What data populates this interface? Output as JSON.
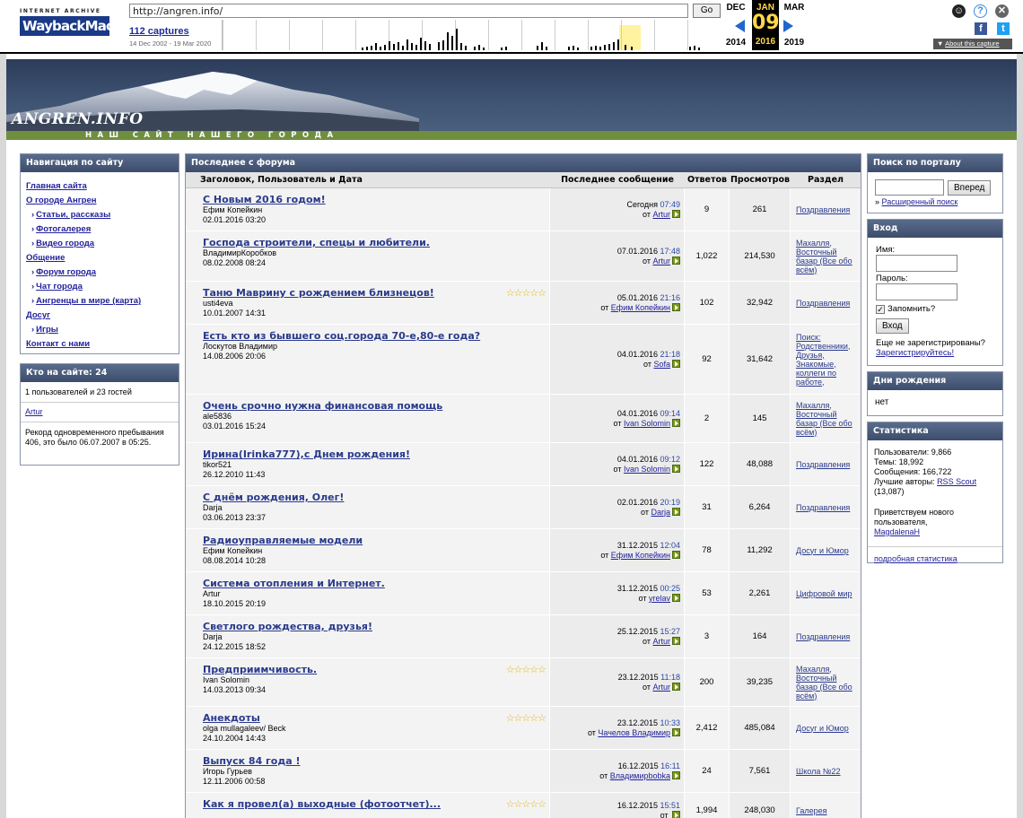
{
  "wayback": {
    "logo_top": "INTERNET ARCHIVE",
    "logo_main": "WaybackMachine",
    "url": "http://angren.info/",
    "go_label": "Go",
    "captures": "112 captures",
    "range": "14 Dec 2002 - 19 Mar 2020",
    "prev_month": "DEC",
    "cur_month": "JAN",
    "next_month": "MAR",
    "cur_day": "09",
    "prev_year": "2014",
    "cur_year": "2016",
    "next_year": "2019",
    "about": "About this capture"
  },
  "site": {
    "logo": "ANGREN.INFO",
    "tagline": "НАШ САЙТ НАШЕГО ГОРОДА"
  },
  "nav": {
    "title": "Навигация по сайту",
    "items": [
      {
        "label": "Главная сайта",
        "sub": false
      },
      {
        "label": "О городе Ангрен",
        "sub": false
      },
      {
        "label": "Статьи, рассказы",
        "sub": true
      },
      {
        "label": "Фотогалерея",
        "sub": true
      },
      {
        "label": "Видео города",
        "sub": true
      },
      {
        "label": "Общение",
        "sub": false
      },
      {
        "label": "Форум города",
        "sub": true
      },
      {
        "label": "Чат города",
        "sub": true
      },
      {
        "label": "Ангренцы в мире (карта)",
        "sub": true
      },
      {
        "label": "Досуг",
        "sub": false
      },
      {
        "label": "Игры",
        "sub": true
      },
      {
        "label": "Контакт с нами",
        "sub": false
      }
    ]
  },
  "online": {
    "title": "Кто на сайте: 24",
    "summary": "1 пользователей и 23 гостей",
    "user": "Artur",
    "record": "Рекорд одновременного пребывания 406, это было 06.07.2007 в 05:25."
  },
  "forum": {
    "title": "Последнее с форума",
    "headers": {
      "topic": "Заголовок, Пользователь и Дата",
      "last": "Последнее сообщение",
      "replies": "Ответов",
      "views": "Просмотров",
      "section": "Раздел"
    },
    "rows": [
      {
        "title": "С Новым 2016 годом!",
        "user": "Ефим Копейкин",
        "date": "02.01.2016 03:20",
        "stars": false,
        "last_date": "Сегодня",
        "last_time": "07:49",
        "last_user": "Artur",
        "replies": "9",
        "views": "261",
        "section": "Поздравления"
      },
      {
        "title": "Господа строители, спецы и любители.",
        "user": "ВладимирКоробков",
        "date": "08.02.2008 08:24",
        "stars": false,
        "last_date": "07.01.2016",
        "last_time": "17:48",
        "last_user": "Artur",
        "replies": "1,022",
        "views": "214,530",
        "section": "Махалля, Восточный базар (Все обо всём)"
      },
      {
        "title": "Таню Маврину с рождением близнецов!",
        "user": "usti4eva",
        "date": "10.01.2007 14:31",
        "stars": true,
        "last_date": "05.01.2016",
        "last_time": "21:16",
        "last_user": "Ефим Копейкин",
        "replies": "102",
        "views": "32,942",
        "section": "Поздравления"
      },
      {
        "title": "Есть кто из бывшего соц.города 70-е,80-е года?",
        "user": "Лоскутов Владимир",
        "date": "14.08.2006 20:06",
        "stars": false,
        "last_date": "04.01.2016",
        "last_time": "21:18",
        "last_user": "Sofa",
        "replies": "92",
        "views": "31,642",
        "section": "Поиск: Родственники, Друзья, Знакомые, коллеги по работе,"
      },
      {
        "title": "Очень срочно нужна финансовая помощь",
        "user": "ale5836",
        "date": "03.01.2016 15:24",
        "stars": false,
        "last_date": "04.01.2016",
        "last_time": "09:14",
        "last_user": "Ivan Solomin",
        "replies": "2",
        "views": "145",
        "section": "Махалля, Восточный базар (Все обо всём)"
      },
      {
        "title": "Ирина(Irinka777),с Днем рождения!",
        "user": "tikor521",
        "date": "26.12.2010 11:43",
        "stars": false,
        "last_date": "04.01.2016",
        "last_time": "09:12",
        "last_user": "Ivan Solomin",
        "replies": "122",
        "views": "48,088",
        "section": "Поздравления"
      },
      {
        "title": "С днём рождения, Олег!",
        "user": "Darja",
        "date": "03.06.2013 23:37",
        "stars": false,
        "last_date": "02.01.2016",
        "last_time": "20:19",
        "last_user": "Darja",
        "replies": "31",
        "views": "6,264",
        "section": "Поздравления"
      },
      {
        "title": "Радиоуправляемые модели",
        "user": "Ефим Копейкин",
        "date": "08.08.2014 10:28",
        "stars": false,
        "last_date": "31.12.2015",
        "last_time": "12:04",
        "last_user": "Ефим Копейкин",
        "replies": "78",
        "views": "11,292",
        "section": "Досуг и Юмор"
      },
      {
        "title": "Система отопления и Интернет.",
        "user": "Artur",
        "date": "18.10.2015 20:19",
        "stars": false,
        "last_date": "31.12.2015",
        "last_time": "00:25",
        "last_user": "yrelav",
        "replies": "53",
        "views": "2,261",
        "section": "Цифровой мир"
      },
      {
        "title": "Светлого рождества, друзья!",
        "user": "Darja",
        "date": "24.12.2015 18:52",
        "stars": false,
        "last_date": "25.12.2015",
        "last_time": "15:27",
        "last_user": "Artur",
        "replies": "3",
        "views": "164",
        "section": "Поздравления"
      },
      {
        "title": "Предприимчивость.",
        "user": "Ivan Solomin",
        "date": "14.03.2013 09:34",
        "stars": true,
        "last_date": "23.12.2015",
        "last_time": "11:18",
        "last_user": "Artur",
        "replies": "200",
        "views": "39,235",
        "section": "Махалля, Восточный базар (Все обо всём)"
      },
      {
        "title": "Анекдоты",
        "user": "olga mullagaleev/ Beck",
        "date": "24.10.2004 14:43",
        "stars": true,
        "last_date": "23.12.2015",
        "last_time": "10:33",
        "last_user": "Чачелов Владимир",
        "replies": "2,412",
        "views": "485,084",
        "section": "Досуг и Юмор"
      },
      {
        "title": "Выпуск 84 года !",
        "user": "Игорь Гурьев",
        "date": "12.11.2006 00:58",
        "stars": false,
        "last_date": "16.12.2015",
        "last_time": "16:11",
        "last_user": "Владимирbobka",
        "replies": "24",
        "views": "7,561",
        "section": "Школа №22"
      },
      {
        "title": "Как я провел(а) выходные (фотоотчет)...",
        "user": "",
        "date": "",
        "stars": true,
        "last_date": "16.12.2015",
        "last_time": "15:51",
        "last_user": "",
        "replies": "1,994",
        "views": "248,030",
        "section": "Галерея"
      }
    ]
  },
  "search": {
    "title": "Поиск по порталу",
    "button": "Вперед",
    "advanced": "Расширенный поиск"
  },
  "login": {
    "title": "Вход",
    "name_label": "Имя:",
    "pass_label": "Пароль:",
    "remember": "Запомнить?",
    "button": "Вход",
    "not_registered": "Еще не зарегистрированы?",
    "register": "Зарегистрируйтесь!"
  },
  "birthdays": {
    "title": "Дни рождения",
    "text": "нет"
  },
  "stats": {
    "title": "Статистика",
    "users": "Пользователи: 9,866",
    "threads": "Темы: 18,992",
    "posts": "Сообщения: 166,722",
    "best_label": "Лучшие авторы:",
    "best_user": "RSS Scout",
    "best_count": "(13,087)",
    "welcome": "Приветствуем нового пользователя,",
    "new_user": "MagdalenaH",
    "detail": "подробная статистика"
  }
}
